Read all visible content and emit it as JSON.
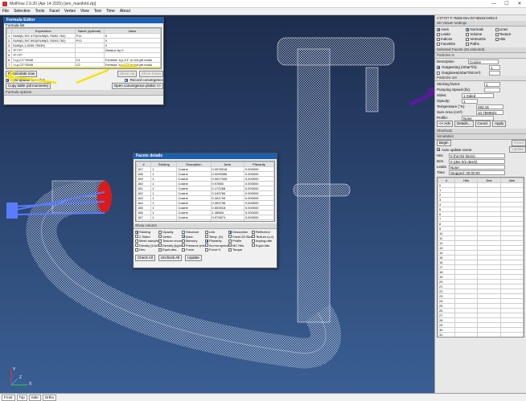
{
  "app": {
    "title": "MolFlow 2.9.20 (Apr 14 2025) [sim_manifold.zip]",
    "win_min": "—",
    "win_max": "☐",
    "win_close": "✕"
  },
  "menu": [
    "File",
    "Selection",
    "Tools",
    "Facet",
    "Vertex",
    "View",
    "Test",
    "Time",
    "About"
  ],
  "formula_editor": {
    "title": "Formula Editor",
    "list_label": "Formula list",
    "cols": [
      "",
      "Expression",
      "Name (optional)",
      "Value"
    ],
    "rows": [
      [
        "1",
        "SUM(D,397,470)/SUM(D,75252,752)",
        "P11",
        "0"
      ],
      [
        "2",
        "SUM(D,397,553)/SUM(D,75243,752)",
        "P12",
        "0"
      ],
      [
        "3",
        "SUM(A,1,4939,75039)",
        "",
        "0"
      ],
      [
        "4",
        "\"P\"/\"P\"",
        "",
        "Division by 0"
      ],
      [
        "5",
        "\"P\"/\"P\"",
        "",
        ""
      ],
      [
        "6",
        "\"u,p,C1\"*2540",
        "C1",
        "Formula \"u,p,C1\" is not yet evalu"
      ],
      [
        "7",
        "\"u,p,C2\"*2540",
        "C2",
        "Formula \"u,p,C2\" is not yet evalu"
      ],
      [
        "8",
        "C2*C1",
        "",
        "45"
      ]
    ],
    "recalc": "Recalculate now",
    "autoupdate": "Auto-update formulas",
    "copy": "Copy table (all moments)",
    "move_up": "Move Up",
    "move_down": "Move Down",
    "record": "Record convergence",
    "open_plotter": "Open convergence plotter >>",
    "options": "Formula options"
  },
  "facets_details": {
    "title": "Facets details",
    "cols": [
      "#",
      "Sticking",
      "Desorption",
      "Area",
      "Planarity"
    ],
    "rows": [
      [
        "157",
        "1",
        "Cosine",
        "0.0078016",
        "0.000000"
      ],
      [
        "158",
        "1",
        "Cosine",
        "0.0295365",
        "0.000000"
      ],
      [
        "159",
        "1",
        "Cosine",
        "0.0027026",
        "0.000000"
      ],
      [
        "160",
        "1",
        "Cosine",
        "0.97850",
        "0.000000"
      ],
      [
        "161",
        "1",
        "Cosine",
        "0.172268",
        "0.000000"
      ],
      [
        "162",
        "1",
        "Cosine",
        "0.243766",
        "0.000000"
      ],
      [
        "163",
        "1",
        "Cosine",
        "0.324793",
        "0.000000"
      ],
      [
        "164",
        "1",
        "Cosine",
        "0.403796",
        "0.000000"
      ],
      [
        "165",
        "1",
        "Cosine",
        "0.503918",
        "0.000000"
      ],
      [
        "166",
        "1",
        "Cosine",
        "1.28584",
        "0.000000"
      ],
      [
        "167",
        "1",
        "Cosine",
        "0.973874",
        "0.000000"
      ],
      [
        "168",
        "1",
        "Cosine",
        "0.87609",
        "0.000000"
      ]
    ],
    "show_column": "Show column",
    "checks": [
      [
        "Sticking",
        true
      ],
      [
        "Opacity",
        false
      ],
      [
        "Structure",
        false
      ],
      [
        "Link",
        false
      ],
      [
        "Desorption",
        true
      ],
      [
        "Reflection",
        false
      ],
      [
        "2 Sided",
        false
      ],
      [
        "Vertex",
        false
      ],
      [
        "Area",
        true
      ],
      [
        "Temp. (K)",
        false
      ],
      [
        "Facet 2D Box",
        false
      ],
      [
        "Texture (u,v)",
        false
      ],
      [
        "Mesh sample/cm",
        false
      ],
      [
        "Texture record",
        false
      ],
      [
        "Memory",
        false
      ],
      [
        "Planarity",
        true
      ],
      [
        "Profile",
        false
      ],
      [
        "Imping.rate",
        false
      ],
      [
        "Density [1/m3]",
        false
      ],
      [
        "Density [kg/m3]",
        false
      ],
      [
        "Pressure [mbar]",
        false
      ],
      [
        "Av.mol.speed",
        false
      ],
      [
        "MC Hits",
        false
      ],
      [
        "Equiv.hits",
        false
      ],
      [
        "Des.",
        false
      ],
      [
        "Equiv.abs.",
        false
      ],
      [
        "Force",
        false
      ],
      [
        "Force^2",
        false
      ],
      [
        "Torque",
        false
      ]
    ],
    "check_all": "Check All",
    "uncheck_all": "Uncheck All",
    "update": "Update"
  },
  "side": {
    "coords": "V:37727 F:75282 Dev:22?46x53.04/52.0",
    "viewer_settings": "3D Viewer settings",
    "viewer_checks": [
      [
        "Axes",
        true
      ],
      [
        "Normals",
        true
      ],
      [
        "Lines",
        false
      ],
      [
        "Leaks",
        false
      ],
      [
        "Volume",
        false
      ],
      [
        "Texture",
        false
      ],
      [
        "Indices",
        false
      ],
      [
        "VertexIDs",
        false
      ],
      [
        "Hits",
        false
      ],
      [
        "FacetIDs",
        false
      ],
      [
        "Paths",
        false
      ]
    ],
    "selected": "Selected Facets (45 selected)",
    "particles_in": "Particles in",
    "desorption_label": "Desorption",
    "desorption_val": "Cosine",
    "outgassing_label": "Outgassing (mbar*l/s):",
    "outgassing_val": "1",
    "outgassing2_label": "Outg/area(mbar*l/s/cm²):",
    "outgassing2_val": "",
    "particles_out": "Particles out",
    "sticking_label": "Sticking factor:",
    "sticking_val": "1",
    "pumping_label": "Pumping Speed (l/s):",
    "pumping_val": "",
    "sides_label": "Sides:",
    "sides_val": "1 Sided",
    "opacity_label": "Opacity:",
    "opacity_val": "1",
    "temp_label": "Temperature (°K):",
    "temp_val": "293.15",
    "area_label": "Sum Area (cm²):",
    "area_val": "10.7569921",
    "profile_label": "Profile:",
    "profile_val": "None",
    "btn_adv": "<< Adv",
    "btn_details": "Details...",
    "btn_coord": "Coord.",
    "btn_apply": "Apply",
    "shortcuts": "Shortcuts",
    "simulation": "Simulation",
    "btn_start": "Begin",
    "btn_reset": "Reset",
    "btn_update": "Update",
    "autoupdate": "Auto update scene",
    "hits_label": "Hits",
    "hits_val": "0 (hit 0/2 hits/s)",
    "des_label": "Des.",
    "des_val": "0 (des 0/2 des/s)",
    "leaks_label": "Leaks",
    "leaks_val": "None",
    "time_label": "Time",
    "time_val": "Stopped: 00:00:00",
    "hitcols": [
      "#",
      "Hits",
      "Des",
      "Abs"
    ],
    "hitrows": [
      "0",
      "1",
      "2",
      "3",
      "4",
      "5",
      "6",
      "7",
      "8",
      "9",
      "10",
      "11",
      "12",
      "13",
      "14",
      "15",
      "16",
      "17",
      "18",
      "19",
      "20",
      "21",
      "22",
      "23",
      "24",
      "25",
      "26",
      "27",
      "28",
      "29",
      "30",
      "31",
      "32",
      "33",
      "34",
      "35",
      "36",
      "37"
    ]
  },
  "bottom": {
    "views": [
      "Front",
      "Top",
      "Side",
      "Ortho"
    ]
  },
  "axis": {
    "y": "Y",
    "x": "X",
    "z": "Z"
  },
  "colors": {
    "highlight": "#f4e500",
    "purple": "#5a1a9a",
    "magenta": "#e0206a",
    "red": "#d91b1b",
    "blue": "#5b7bff"
  }
}
